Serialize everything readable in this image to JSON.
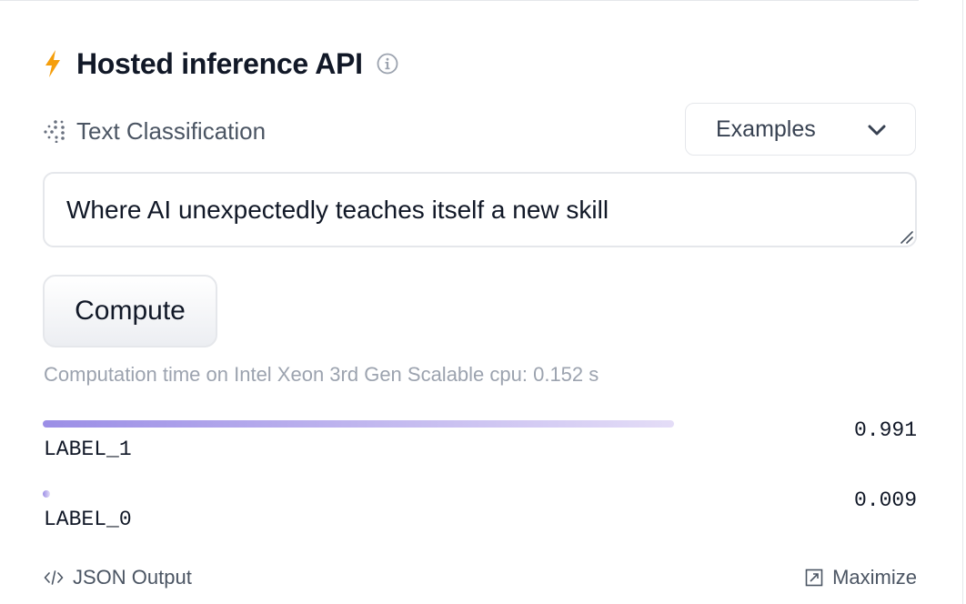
{
  "widget": {
    "title": "Hosted inference API",
    "task": "Text Classification",
    "examples_label": "Examples",
    "input_value": "Where AI unexpectedly teaches itself a new skill",
    "compute_label": "Compute",
    "timing": "Computation time on Intel Xeon 3rd Gen Scalable cpu: 0.152 s"
  },
  "results": [
    {
      "label": "LABEL_1",
      "score": 0.991,
      "score_text": "0.991"
    },
    {
      "label": "LABEL_0",
      "score": 0.009,
      "score_text": "0.009"
    }
  ],
  "footer": {
    "json_output": "JSON Output",
    "maximize": "Maximize"
  },
  "colors": {
    "accent_bolt": "#f59e0b",
    "bar_start": "#9b8ee6",
    "bar_end": "#e4ddf7"
  },
  "icons": {
    "header": "lightning-bolt-icon",
    "info": "info-circle-icon",
    "task": "dotted-grid-icon",
    "dropdown": "chevron-down-icon",
    "resize": "resize-handle-icon",
    "code": "code-brackets-icon",
    "maximize": "maximize-icon"
  }
}
